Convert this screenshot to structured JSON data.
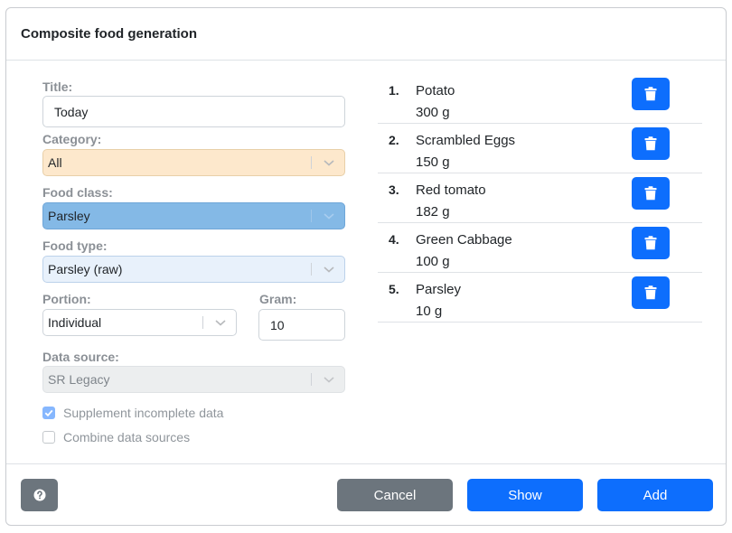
{
  "dialog": {
    "title": "Composite food generation"
  },
  "form": {
    "title_label": "Title:",
    "title_value": "Today",
    "category_label": "Category:",
    "category_value": "All",
    "food_class_label": "Food class:",
    "food_class_value": "Parsley",
    "food_type_label": "Food type:",
    "food_type_value": "Parsley (raw)",
    "portion_label": "Portion:",
    "portion_value": "Individual",
    "gram_label": "Gram:",
    "gram_value": "10",
    "data_source_label": "Data source:",
    "data_source_value": "SR Legacy",
    "supplement_label": "Supplement incomplete data",
    "supplement_checked": true,
    "combine_label": "Combine data sources",
    "combine_checked": false
  },
  "items": [
    {
      "num": "1.",
      "name": "Potato",
      "amount": "300 g"
    },
    {
      "num": "2.",
      "name": "Scrambled Eggs",
      "amount": "150 g"
    },
    {
      "num": "3.",
      "name": "Red tomato",
      "amount": "182 g"
    },
    {
      "num": "4.",
      "name": "Green Cabbage",
      "amount": "100 g"
    },
    {
      "num": "5.",
      "name": "Parsley",
      "amount": "10 g"
    }
  ],
  "icons": {
    "delete": "trash-icon",
    "help": "question-circle-icon",
    "dropdown": "chevron-down-icon",
    "check": "check-icon"
  },
  "footer": {
    "cancel_label": "Cancel",
    "show_label": "Show",
    "add_label": "Add"
  },
  "colors": {
    "primary": "#0d6efd",
    "secondary": "#6c757d",
    "category_bg": "#fde8cc",
    "food_class_bg": "#84b9e6",
    "food_type_bg": "#e8f1fb"
  }
}
